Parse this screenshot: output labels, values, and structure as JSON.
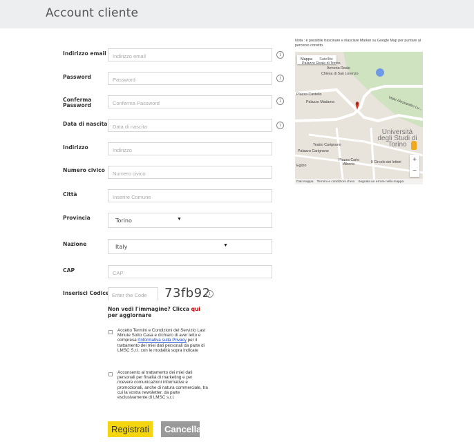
{
  "header": {
    "title": "Account cliente"
  },
  "form": {
    "fields": [
      {
        "label": "Indirizzo email",
        "placeholder": "Indirizzo email"
      },
      {
        "label": "Password",
        "placeholder": "Password"
      },
      {
        "label": "Conferma Password",
        "placeholder": "Conferma Password"
      },
      {
        "label": "Data di nascita",
        "placeholder": "Data di nascita"
      },
      {
        "label": "Indirizzo",
        "placeholder": "Indirizzo"
      },
      {
        "label": "Numero civico",
        "placeholder": "Numero civico"
      },
      {
        "label": "Città",
        "placeholder": "Inserire Comune"
      }
    ],
    "provincia": {
      "label": "Provincia",
      "value": "Torino"
    },
    "nazione": {
      "label": "Nazione",
      "value": "Italy"
    },
    "cap": {
      "label": "CAP",
      "placeholder": "CAP"
    },
    "codice": {
      "label": "Inserisci Codice",
      "placeholder": "Enter the Code",
      "captcha": "73fb92",
      "refresh_prefix": "Non vedi l'immagine? Clicca ",
      "refresh_link": "qui",
      "refresh_suffix": " per aggiornare"
    },
    "info_icon": "i",
    "consent1": {
      "text_before": "Accetto Termini e Condizioni del Servizio Last Minute Sotto Casa e dichiaro di aver letto e compresa ",
      "link": "l'informativa sulla Privacy",
      "text_after": " per il trattamento dei miei dati personali da parte di LMSC S.r.l. con le modalità sopra indicate"
    },
    "consent2": {
      "text": "Acconsento al trattamento dei miei dati personali per finalità di marketing e per ricevere comunicazioni informative e promozionali, anche di natura commerciale, tra cui la vostra newsletter, da parte esclusivamente di LMSC s.r.l."
    },
    "buttons": {
      "submit": "Registrati",
      "cancel": "Cancella"
    }
  },
  "map": {
    "note": "Nota : è possibile trascinare e rilasciare Marker su Google Map per puntare al percorso corretto.",
    "tabs": [
      "Mappa",
      "Satellite"
    ],
    "labels": {
      "l1": "Palazzo Reale di Torino",
      "l2": "Armeria Reale",
      "l3": "Chiesa di San Lorenzo",
      "l4": "Piazza Castello",
      "l5": "Palazzo Madama",
      "l6": "Teatro Carignano",
      "l7": "Palazzo Carignano",
      "l8": "Piazza Carlo Alberto",
      "l9": "Il Circolo dei lettori",
      "l10": "Egizio",
      "l11": "Viale Alessandro Lu...",
      "big": "Università degli Studi di Torino"
    },
    "zoom_in": "+",
    "zoom_out": "−",
    "footer": [
      "Dati mappa",
      "Termini e condizioni d'uso",
      "Segnala un errore nella mappa"
    ],
    "colors": {
      "park": "#cfe3c1",
      "road": "#ffffff",
      "marker": "#d33a2c",
      "water": "#6e9ae8"
    }
  }
}
